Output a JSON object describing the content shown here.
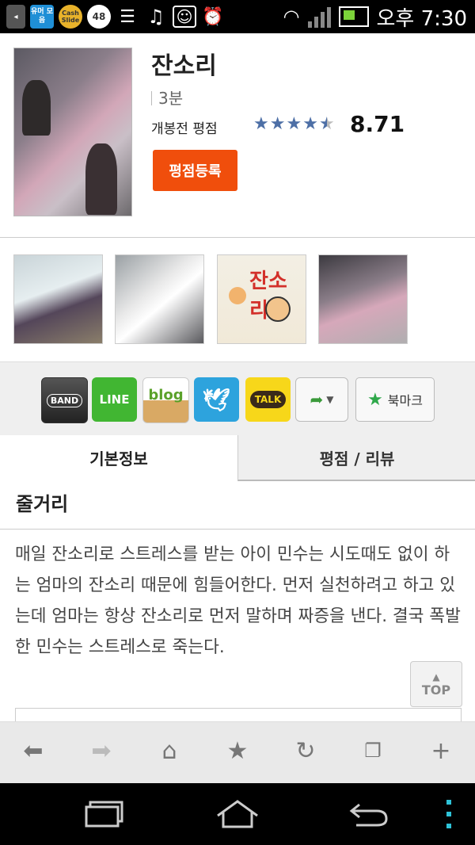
{
  "status_bar": {
    "icons": [
      {
        "name": "yumi-app-icon",
        "text": "유머 모음"
      },
      {
        "name": "cashslide-icon",
        "text": "Cash Slide"
      },
      {
        "name": "paw-badge-icon",
        "text": "48"
      }
    ],
    "time": "오후 7:30"
  },
  "movie": {
    "title": "잔소리",
    "runtime": "3분",
    "rating_label": "개봉전 평점",
    "rating_stars": 4.5,
    "rating_score": "8.71",
    "rate_button": "평점등록"
  },
  "share": {
    "band": "BAND",
    "line": "LINE",
    "blog": "blog",
    "talk": "TALK",
    "bookmark": "북마크"
  },
  "tabs": {
    "basic_info": "기본정보",
    "review": "평점 / 리뷰"
  },
  "synopsis": {
    "heading": "줄거리",
    "text": "매일 잔소리로 스트레스를 받는 아이 민수는 시도때도 없이 하는 엄마의 잔소리 때문에 힘들어한다. 먼저 실천하려고 하고 있는데 엄마는 항상 잔소리로 먼저 말하며 짜증을 낸다. 결국 폭발한 민수는 스트레스로 죽는다."
  },
  "top_button": "TOP",
  "colors": {
    "rate_button": "#f04e0c",
    "star": "#4d6fa6"
  }
}
